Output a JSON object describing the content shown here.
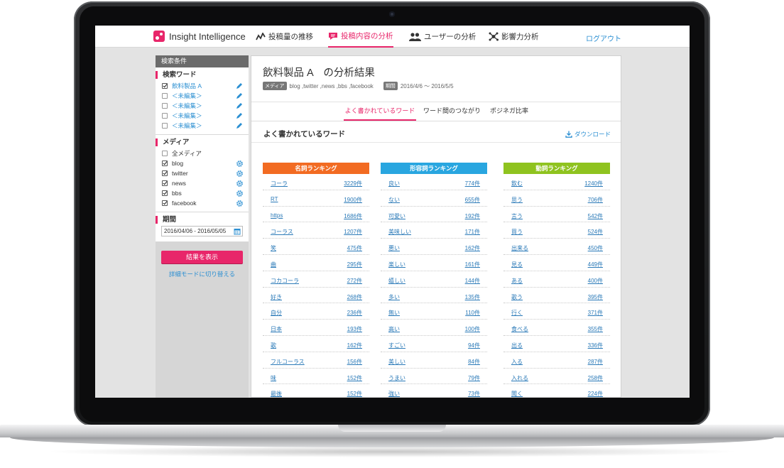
{
  "header": {
    "brand": "Insight Intelligence",
    "nav": [
      {
        "label": "投稿量の推移",
        "icon": "line-chart-icon",
        "active": false
      },
      {
        "label": "投稿内容の分析",
        "icon": "speech-bubble-icon",
        "active": true
      },
      {
        "label": "ユーザーの分析",
        "icon": "users-icon",
        "active": false
      },
      {
        "label": "影響力分析",
        "icon": "network-icon",
        "active": false
      }
    ],
    "logout": "ログアウト"
  },
  "sidebar": {
    "heading": "検索条件",
    "keywords_title": "検索ワード",
    "keywords": [
      {
        "label": "飲料製品 A",
        "checked": true
      },
      {
        "label": "＜未編集＞",
        "checked": false
      },
      {
        "label": "＜未編集＞",
        "checked": false
      },
      {
        "label": "＜未編集＞",
        "checked": false
      },
      {
        "label": "＜未編集＞",
        "checked": false
      }
    ],
    "media_title": "メディア",
    "media": [
      {
        "label": "全メディア",
        "checked": false
      },
      {
        "label": "blog",
        "checked": true
      },
      {
        "label": "twitter",
        "checked": true
      },
      {
        "label": "news",
        "checked": true
      },
      {
        "label": "bbs",
        "checked": true
      },
      {
        "label": "facebook",
        "checked": true
      }
    ],
    "period_title": "期間",
    "period_value": "2016/04/06 - 2016/05/05",
    "show_button": "結果を表示",
    "switch_link": "詳細モードに切り替える"
  },
  "main": {
    "title": "飲料製品 A　の分析結果",
    "media_tag": "メディア",
    "media_value": "blog ,twitter ,news ,bbs ,facebook",
    "period_tag": "期間",
    "period_value": "2016/4/6 ～ 2016/5/5",
    "tabs": [
      {
        "label": "よく書かれているワード",
        "active": true
      },
      {
        "label": "ワード間のつながり",
        "active": false
      },
      {
        "label": "ポジネガ比率",
        "active": false
      }
    ],
    "section_title": "よく書かれているワード",
    "download": "ダウンロード",
    "rankings": [
      {
        "title": "名詞ランキング",
        "color": "#f26b22",
        "rows": [
          {
            "word": "コーラ",
            "count": "3229件"
          },
          {
            "word": "RT",
            "count": "1900件"
          },
          {
            "word": "https",
            "count": "1686件"
          },
          {
            "word": "コーラス",
            "count": "1207件"
          },
          {
            "word": "笑",
            "count": "475件"
          },
          {
            "word": "曲",
            "count": "295件"
          },
          {
            "word": "コカコーラ",
            "count": "272件"
          },
          {
            "word": "好き",
            "count": "268件"
          },
          {
            "word": "自分",
            "count": "236件"
          },
          {
            "word": "日本",
            "count": "193件"
          },
          {
            "word": "歌",
            "count": "162件"
          },
          {
            "word": "フルコーラス",
            "count": "156件"
          },
          {
            "word": "味",
            "count": "152件"
          },
          {
            "word": "最後",
            "count": "152件"
          }
        ]
      },
      {
        "title": "形容詞ランキング",
        "color": "#29a6e0",
        "rows": [
          {
            "word": "良い",
            "count": "774件"
          },
          {
            "word": "ない",
            "count": "655件"
          },
          {
            "word": "可愛い",
            "count": "192件"
          },
          {
            "word": "美味しい",
            "count": "171件"
          },
          {
            "word": "悪い",
            "count": "162件"
          },
          {
            "word": "楽しい",
            "count": "161件"
          },
          {
            "word": "嬉しい",
            "count": "144件"
          },
          {
            "word": "多い",
            "count": "135件"
          },
          {
            "word": "無い",
            "count": "110件"
          },
          {
            "word": "高い",
            "count": "100件"
          },
          {
            "word": "すごい",
            "count": "94件"
          },
          {
            "word": "美しい",
            "count": "84件"
          },
          {
            "word": "うまい",
            "count": "79件"
          },
          {
            "word": "強い",
            "count": "73件"
          }
        ]
      },
      {
        "title": "動詞ランキング",
        "color": "#8fc31f",
        "rows": [
          {
            "word": "飲む",
            "count": "1240件"
          },
          {
            "word": "思う",
            "count": "706件"
          },
          {
            "word": "言う",
            "count": "542件"
          },
          {
            "word": "買う",
            "count": "524件"
          },
          {
            "word": "出来る",
            "count": "450件"
          },
          {
            "word": "見る",
            "count": "449件"
          },
          {
            "word": "ある",
            "count": "400件"
          },
          {
            "word": "歌う",
            "count": "395件"
          },
          {
            "word": "行く",
            "count": "371件"
          },
          {
            "word": "食べる",
            "count": "355件"
          },
          {
            "word": "出る",
            "count": "336件"
          },
          {
            "word": "入る",
            "count": "287件"
          },
          {
            "word": "入れる",
            "count": "258件"
          },
          {
            "word": "聞く",
            "count": "224件"
          }
        ]
      }
    ]
  }
}
